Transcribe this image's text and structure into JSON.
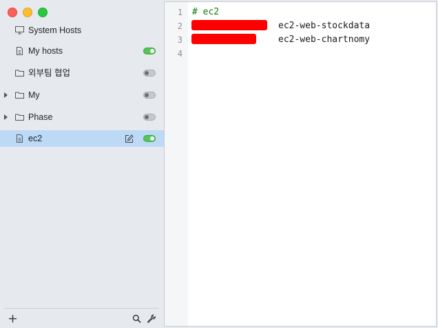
{
  "sidebar": {
    "items": [
      {
        "label": "System Hosts",
        "icon": "monitor-icon",
        "toggle": null,
        "expandable": false,
        "active": false
      },
      {
        "label": "My hosts",
        "icon": "document-icon",
        "toggle": "on",
        "expandable": false,
        "active": false
      },
      {
        "label": "외부팀 협업",
        "icon": "folder-icon",
        "toggle": "off",
        "expandable": false,
        "active": false
      },
      {
        "label": "My",
        "icon": "folder-icon",
        "toggle": "off",
        "expandable": true,
        "active": false
      },
      {
        "label": "Phase",
        "icon": "folder-icon",
        "toggle": "off",
        "expandable": true,
        "active": false
      },
      {
        "label": "ec2",
        "icon": "document-icon",
        "toggle": "on",
        "expandable": false,
        "active": true
      }
    ]
  },
  "bottombar": {
    "add_icon": "plus-icon",
    "search_icon": "search-icon",
    "settings_icon": "wrench-icon"
  },
  "editor": {
    "line_numbers": [
      "1",
      "2",
      "3",
      "4"
    ],
    "lines": [
      {
        "text": "# ec2",
        "type": "comment"
      },
      {
        "text": "ec2-web-stockdata",
        "type": "host",
        "ip_redacted": true
      },
      {
        "text": "ec2-web-chartnomy",
        "type": "host",
        "ip_redacted": true
      },
      {
        "text": "",
        "type": "empty"
      }
    ]
  },
  "colors": {
    "toggle_on": "#53c755",
    "toggle_off": "#c5c8cd",
    "active_row": "#bcd9f5",
    "comment": "#0d7d0d",
    "redaction": "#ff0000"
  }
}
